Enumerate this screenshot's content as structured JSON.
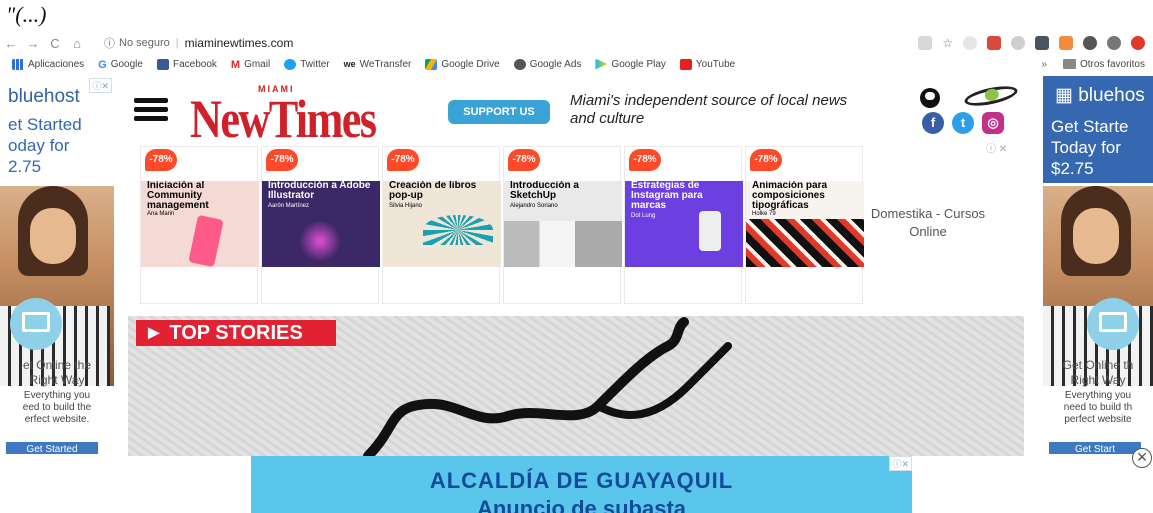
{
  "quote": "\"(...)",
  "browser": {
    "insecure_label": "No seguro",
    "url": "miaminewtimes.com",
    "back_icon": "arrow-left-icon",
    "forward_icon": "arrow-right-icon"
  },
  "bookmarks": {
    "items": [
      "Aplicaciones",
      "Google",
      "Facebook",
      "Gmail",
      "Twitter",
      "WeTransfer",
      "Google Drive",
      "Google Ads",
      "Google Play",
      "YouTube"
    ],
    "more": "»",
    "other_favorites": "Otros favoritos"
  },
  "side_ad_left": {
    "brand": "bluehost",
    "headline_1": "et Started",
    "headline_2": "oday for",
    "headline_3": "2.75",
    "get_online_1": "et Online the",
    "get_online_2": "Right Way",
    "everything_1": "Everything you",
    "everything_2": "eed to build the",
    "everything_3": "erfect website.",
    "cta": "Get Started"
  },
  "side_ad_right": {
    "brand": "bluehos",
    "headline_1": "Get Starte",
    "headline_2": "Today for",
    "headline_3": "$2.75",
    "get_online_1": "Get Online th",
    "get_online_2": "Right Way",
    "everything_1": "Everything you",
    "everything_2": "need to build th",
    "everything_3": "perfect website",
    "cta": "Get Start"
  },
  "header": {
    "logo_miami": "MIAMI",
    "logo_title": "NewTimes",
    "support_button": "SUPPORT US",
    "tagline": "Miami's independent source of local news and culture"
  },
  "courses": [
    {
      "badge": "-78%",
      "title": "Iniciación al Community management",
      "author": "Ana Marin",
      "bg": "#f4d9d4",
      "fg": "#111"
    },
    {
      "badge": "-78%",
      "title": "Introducción a Adobe Illustrator",
      "author": "Aarón Martínez",
      "bg": "#3b2866",
      "fg": "#fff"
    },
    {
      "badge": "-78%",
      "title": "Creación de libros pop-up",
      "author": "Silvia Hijano",
      "bg": "#efe6d8",
      "fg": "#111"
    },
    {
      "badge": "-78%",
      "title": "Introducción a SketchUp",
      "author": "Alejandro Soriano",
      "bg": "#e9e9e9",
      "fg": "#111"
    },
    {
      "badge": "-78%",
      "title": "Estrategias de Instagram para marcas",
      "author": "Dot Lung",
      "bg": "#6b3fe0",
      "fg": "#fff"
    },
    {
      "badge": "-78%",
      "title": "Animación para composiciones tipográficas",
      "author": "Holke 79",
      "bg": "#f7f3ef",
      "fg": "#111"
    }
  ],
  "domestika_label": "Domestika - Cursos Online",
  "stories": {
    "label": "► TOP STORIES"
  },
  "bottom_ad": {
    "line1": "ALCALDÍA DE GUAYAQUIL",
    "line2": "Anuncio de subasta"
  }
}
